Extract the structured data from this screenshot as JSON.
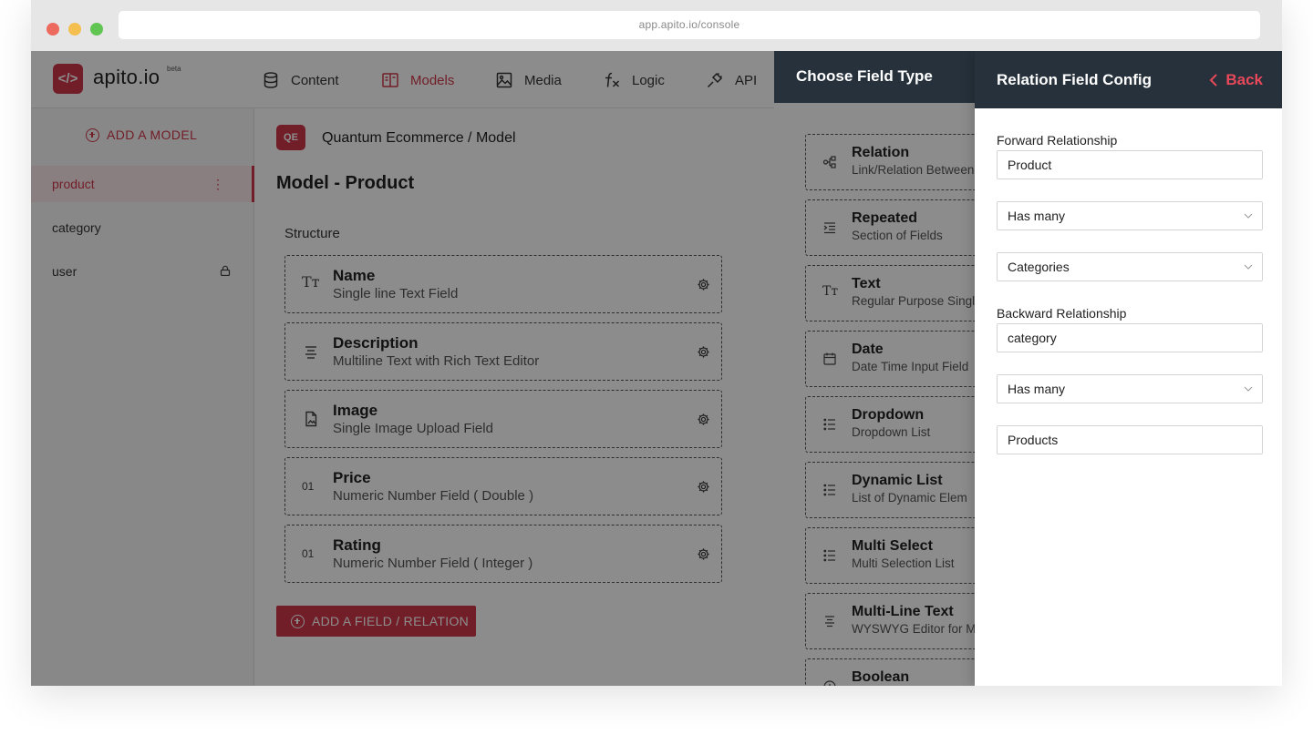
{
  "browser": {
    "url": "app.apito.io/console",
    "dot_colors": [
      "#ec6b5e",
      "#f4bf4f",
      "#61c554"
    ]
  },
  "brand": {
    "logo_glyph": "</>",
    "name": "apito.io",
    "badge": "beta",
    "accent": "#d0384a"
  },
  "nav": [
    {
      "label": "Content",
      "icon": "database-icon"
    },
    {
      "label": "Models",
      "icon": "book-icon",
      "active": true
    },
    {
      "label": "Media",
      "icon": "image-icon"
    },
    {
      "label": "Logic",
      "icon": "function-icon"
    },
    {
      "label": "API",
      "icon": "plug-icon"
    }
  ],
  "sidebar": {
    "add_label": "ADD A MODEL",
    "items": [
      {
        "label": "product",
        "active": true,
        "icon": "kebab-icon"
      },
      {
        "label": "category"
      },
      {
        "label": "user",
        "icon": "lock-icon"
      }
    ]
  },
  "main": {
    "project_badge": "QE",
    "breadcrumb": "Quantum Ecommerce  /  Model",
    "title": "Model - Product",
    "structure_label": "Structure",
    "fields": [
      {
        "name": "Name",
        "desc": "Single line Text Field",
        "icon": "text-icon"
      },
      {
        "name": "Description",
        "desc": "Multiline Text with Rich Text Editor",
        "icon": "align-icon"
      },
      {
        "name": "Image",
        "desc": "Single Image Upload Field",
        "icon": "file-image-icon"
      },
      {
        "name": "Price",
        "desc": "Numeric Number Field ( Double )",
        "icon": "number-icon"
      },
      {
        "name": "Rating",
        "desc": "Numeric Number Field ( Integer )",
        "icon": "number-icon"
      }
    ],
    "number_glyph": "01",
    "text_glyph": "Tт",
    "add_field_label": "ADD A FIELD / RELATION"
  },
  "field_types": {
    "title": "Choose Field Type",
    "items": [
      {
        "name": "Relation",
        "desc": "Link/Relation Between",
        "icon": "relation-icon"
      },
      {
        "name": "Repeated",
        "desc": "Section of Fields",
        "icon": "indent-icon"
      },
      {
        "name": "Text",
        "desc": "Regular Purpose Single",
        "icon": "text-icon"
      },
      {
        "name": "Date",
        "desc": "Date Time Input Field",
        "icon": "calendar-icon"
      },
      {
        "name": "Dropdown",
        "desc": "Dropdown List",
        "icon": "list-icon"
      },
      {
        "name": "Dynamic List",
        "desc": "List of Dynamic Elem",
        "icon": "list-icon"
      },
      {
        "name": "Multi Select",
        "desc": "Multi Selection List",
        "icon": "list-icon"
      },
      {
        "name": "Multi-Line Text",
        "desc": "WYSWYG Editor for M",
        "icon": "align-icon"
      },
      {
        "name": "Boolean",
        "desc": "",
        "icon": "toggle-icon"
      }
    ]
  },
  "config": {
    "title": "Relation Field Config",
    "back_label": "Back",
    "forward_label": "Forward Relationship",
    "forward_value": "Product",
    "forward_type": "Has many",
    "forward_target": "Categories",
    "backward_label": "Backward Relationship",
    "backward_value": "category",
    "backward_type": "Has many",
    "backward_target": "Products"
  }
}
